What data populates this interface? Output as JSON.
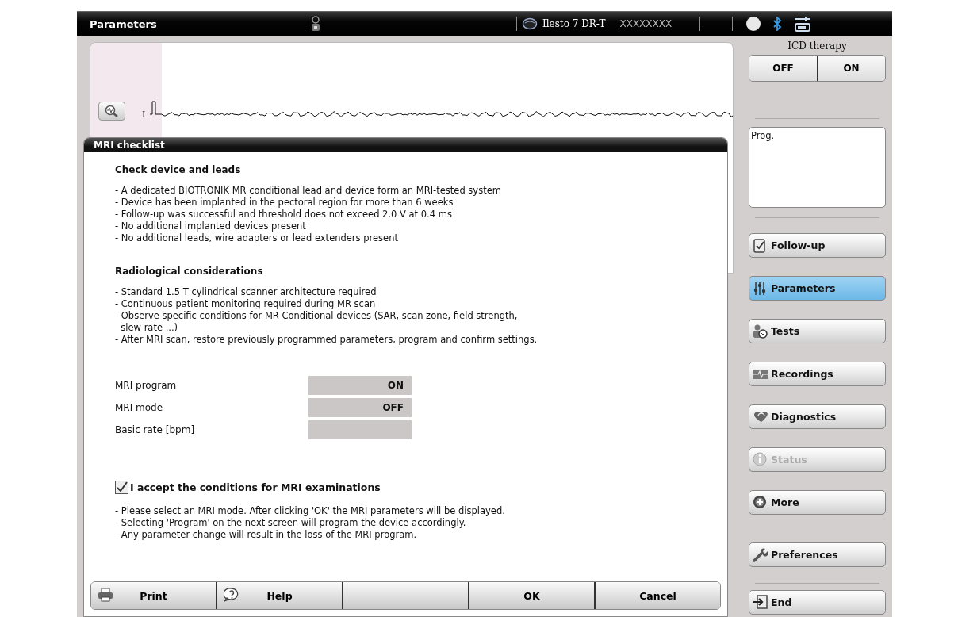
{
  "header": {
    "title": "Parameters",
    "device": "Ilesto 7 DR-T",
    "serial": "XXXXXXXX"
  },
  "waveform": {
    "channel": "I"
  },
  "dialog": {
    "title": "MRI checklist",
    "sections": [
      {
        "heading": "Check device and leads",
        "items": [
          "- A dedicated BIOTRONIK MR conditional lead and device form an MRI-tested system",
          "- Device has been implanted in the pectoral region for more than 6 weeks",
          "- Follow-up was successful and threshold does not exceed 2.0 V at 0.4 ms",
          "- No additional implanted devices present",
          "- No additional leads, wire adapters or lead extenders present"
        ]
      },
      {
        "heading": "Radiological considerations",
        "items": [
          "- Standard 1.5 T cylindrical scanner architecture required",
          "- Continuous patient monitoring required during MR scan",
          "- Observe specific conditions for MR Conditional devices (SAR, scan zone, field strength,\n  slew rate ...)",
          "- After MRI scan, restore previously programmed parameters, program and confirm settings."
        ]
      }
    ],
    "fields": [
      {
        "label": "MRI program",
        "value": "ON"
      },
      {
        "label": "MRI mode",
        "value": "OFF"
      },
      {
        "label": "Basic rate [bpm]"
      }
    ],
    "accept": {
      "label": "I accept the conditions for MRI examinations",
      "checked": true
    },
    "notes": [
      "- Please select an MRI mode. After clicking 'OK' the MRI parameters will be displayed.",
      "- Selecting 'Program' on the next screen will program the device accordingly.",
      "- Any parameter change will result in the loss of the MRI program."
    ],
    "buttons": [
      {
        "kind": "print",
        "label": "Print"
      },
      {
        "kind": "help",
        "label": "Help"
      },
      {
        "kind": "empty"
      },
      {
        "kind": "plain",
        "label": "OK"
      },
      {
        "kind": "plain",
        "label": "Cancel"
      }
    ]
  },
  "sidebar": {
    "therapy_label": "ICD therapy",
    "therapy_options": [
      "OFF",
      "ON"
    ],
    "prog_text": "Prog.",
    "nav": [
      {
        "label": "Follow-up",
        "kind": "clipboard",
        "selected": false,
        "disabled": false
      },
      {
        "label": "Parameters",
        "kind": "sliders",
        "selected": true,
        "disabled": false
      },
      {
        "label": "Tests",
        "kind": "tests",
        "selected": false,
        "disabled": false
      },
      {
        "label": "Recordings",
        "kind": "recording",
        "selected": false,
        "disabled": false
      },
      {
        "label": "Diagnostics",
        "kind": "diagnostics",
        "selected": false,
        "disabled": false
      },
      {
        "label": "Status",
        "kind": "info",
        "selected": false,
        "disabled": true
      },
      {
        "label": "More",
        "kind": "plus",
        "selected": false,
        "disabled": false
      }
    ],
    "footer": [
      {
        "label": "Preferences",
        "kind": "wrench"
      },
      {
        "label": "End",
        "kind": "exit"
      }
    ]
  }
}
